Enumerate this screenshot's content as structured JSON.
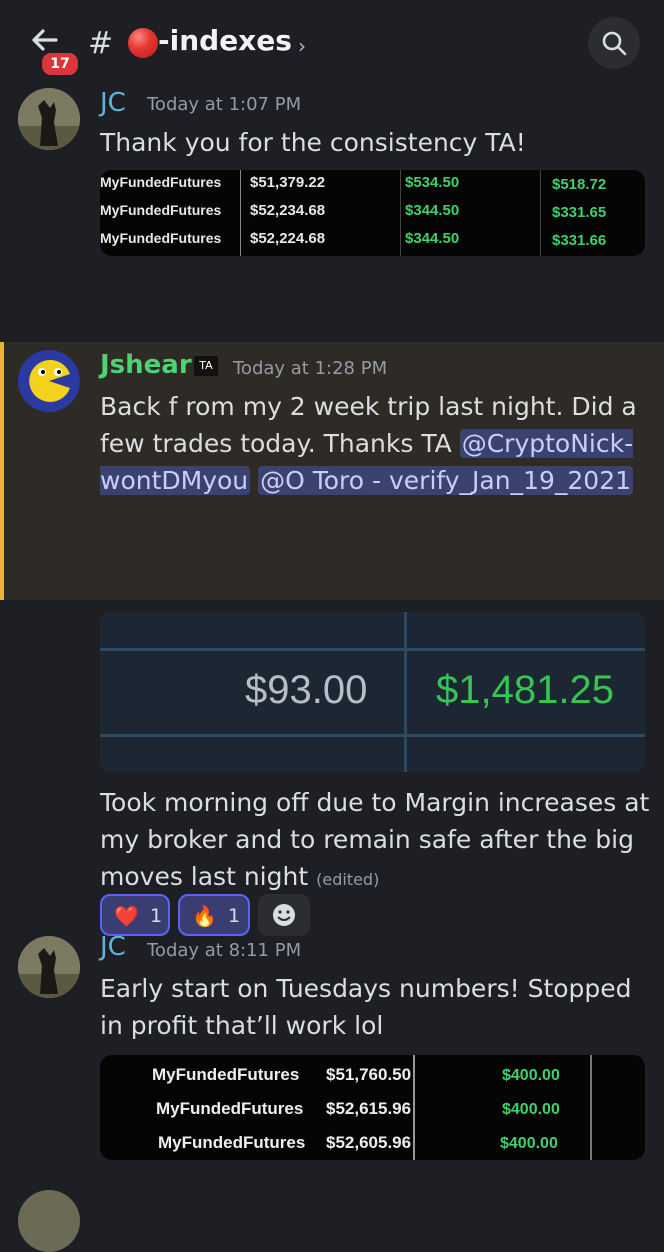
{
  "header": {
    "unread_count": "17",
    "hash": "#",
    "channel": "-indexes",
    "chevron": "›",
    "icons": {
      "back": "arrow-left-icon",
      "search": "search-icon",
      "status": "red-circle-icon"
    }
  },
  "messages": [
    {
      "author": "JC",
      "author_color": "#5fb4d9",
      "timestamp": "Today at 1:07 PM",
      "text": "Thank you for the consistency TA!",
      "image_rows": [
        {
          "name": "MyFundedFutures",
          "balance": "$51,379.22",
          "pnl": "$534.50",
          "net": "$518.72"
        },
        {
          "name": "MyFundedFutures",
          "balance": "$52,234.68",
          "pnl": "$344.50",
          "net": "$331.65"
        },
        {
          "name": "MyFundedFutures",
          "balance": "$52,224.68",
          "pnl": "$344.50",
          "net": "$331.66"
        }
      ]
    },
    {
      "author": "Jshear",
      "author_color": "#4fd372",
      "role_badge": "TA",
      "timestamp": "Today at 1:28 PM",
      "text_part1": "Back f rom my 2 week trip last night. Did a few trades today. Thanks TA ",
      "mention1": "@CryptoNick-wontDMyou",
      "mention2": "@O Toro - verify_Jan_19_2021",
      "reactions": [
        {
          "emoji": "❤️",
          "count": "1"
        },
        {
          "emoji": "🔥",
          "count": "1"
        }
      ],
      "image_values": {
        "left": "$93.00",
        "right": "$1,481.25"
      },
      "text2": "Took morning off due to Margin increases at my broker and to remain safe after the big moves last night",
      "edited": "(edited)"
    },
    {
      "author": "JC",
      "author_color": "#5fb4d9",
      "timestamp": "Today at 8:11 PM",
      "text": "Early start on Tuesdays numbers! Stopped in profit that’ll work lol",
      "image_rows": [
        {
          "name": "MyFundedFutures",
          "balance": "$51,760.50",
          "pnl": "$400.00"
        },
        {
          "name": "MyFundedFutures",
          "balance": "$52,615.96",
          "pnl": "$400.00"
        },
        {
          "name": "MyFundedFutures",
          "balance": "$52,605.96",
          "pnl": "$400.00"
        }
      ]
    }
  ]
}
